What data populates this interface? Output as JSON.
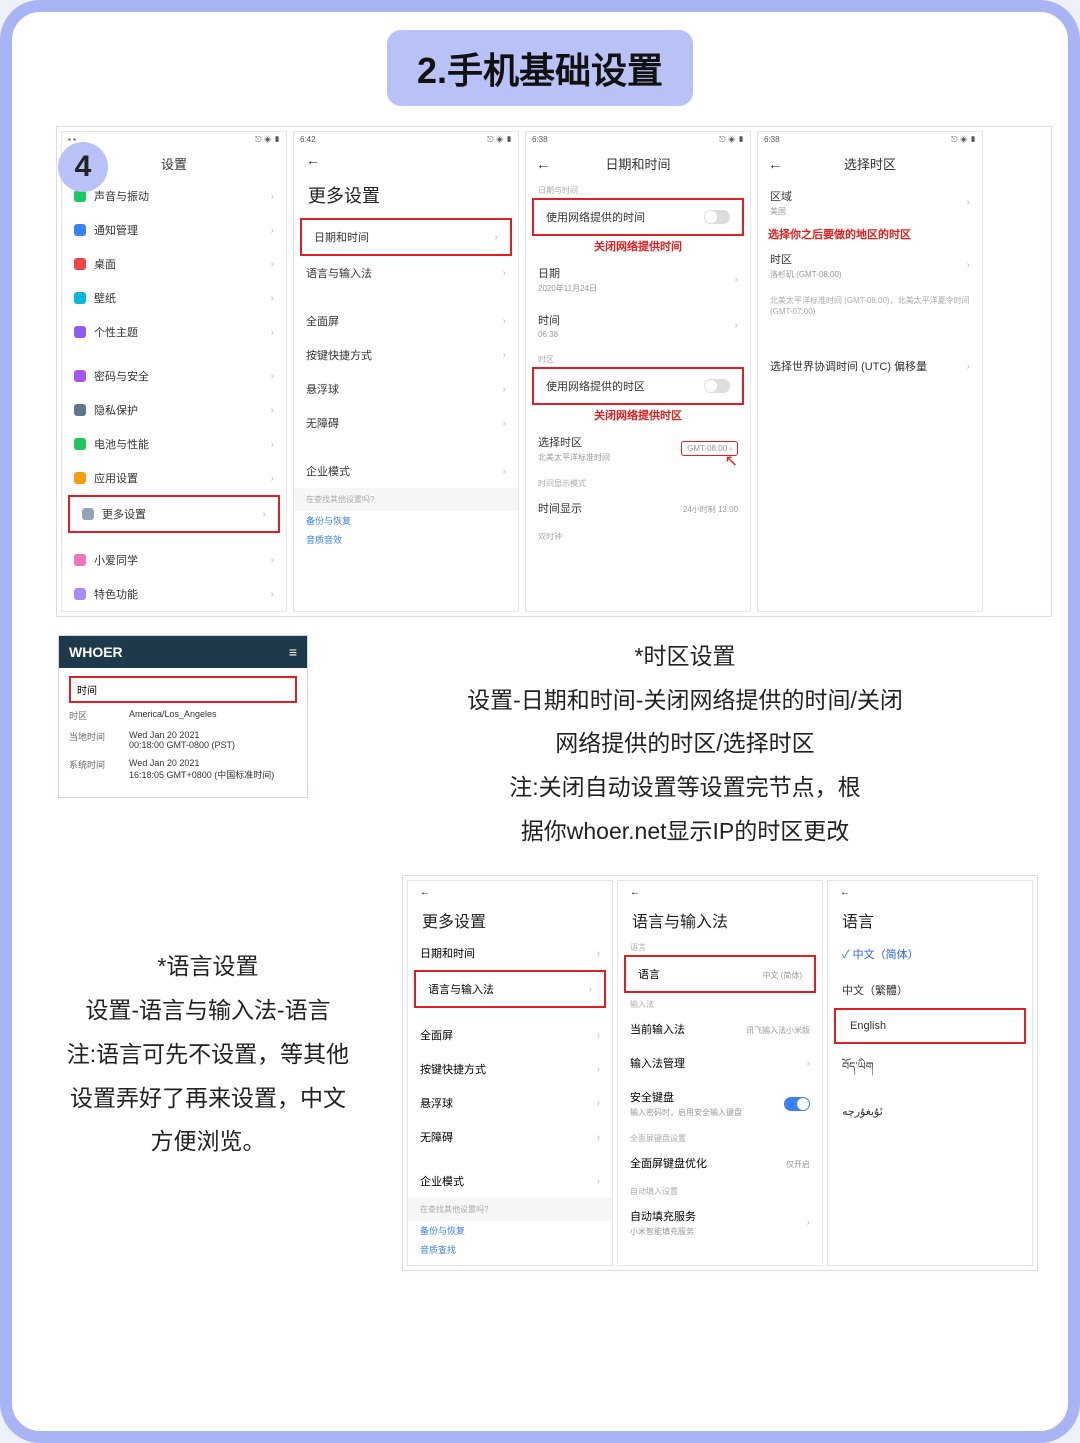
{
  "title": "2.手机基础设置",
  "step": "4",
  "topRow": {
    "p1": {
      "time": "",
      "header": "设置",
      "items": [
        "声音与振动",
        "通知管理",
        "桌面",
        "壁纸",
        "个性主题",
        "密码与安全",
        "隐私保护",
        "电池与性能",
        "应用设置",
        "更多设置",
        "小爱同学",
        "特色功能"
      ]
    },
    "p2": {
      "time": "6:42",
      "header": "更多设置",
      "items": [
        "日期和时间",
        "语言与输入法",
        "全面屏",
        "按键快捷方式",
        "悬浮球",
        "无障碍",
        "企业模式"
      ],
      "footQ": "在查找其他设置吗?",
      "footLinks": [
        "备份与恢复",
        "音质音效"
      ]
    },
    "p3": {
      "time": "6:38",
      "header": "日期和时间",
      "secA": "日期与时间",
      "netTime": "使用网络提供的时间",
      "note1": "关闭网络提供时间",
      "dateLab": "日期",
      "dateVal": "2020年11月24日",
      "timeLab": "时间",
      "timeVal": "06:38",
      "secB": "时区",
      "netZone": "使用网络提供的时区",
      "note2": "关闭网络提供时区",
      "selZone": "选择时区",
      "selZoneSub": "北美太平洋标准时间",
      "gmt": "GMT-08:00",
      "secC": "时间显示模式",
      "timeDisp": "时间显示",
      "timeDispVal": "24小时制 13:00",
      "secD": "双时钟"
    },
    "p4": {
      "time": "6:38",
      "header": "选择时区",
      "region": "区域",
      "regionVal": "美国",
      "annot": "选择你之后要做的地区的时区",
      "tzLab": "时区",
      "tzVal": "洛杉矶 (GMT-08:00)",
      "tzSub": "北美太平洋标准时间 (GMT-08:00)，北美太平洋夏令时间 (GMT-07:00)",
      "utc": "选择世界协调时间 (UTC) 偏移量"
    }
  },
  "explain1": {
    "t": "*时区设置",
    "l1": "设置-日期和时间-关闭网络提供的时间/关闭",
    "l2": "网络提供的时区/选择时区",
    "l3": "注:关闭自动设置等设置完节点，根",
    "l4": "据你whoer.net显示IP的时区更改"
  },
  "whoer": {
    "brand": "WHOER",
    "menu": "≡",
    "tab": "时间",
    "rows": [
      {
        "k": "时区",
        "v": "America/Los_Angeles"
      },
      {
        "k": "当地时间",
        "v": "Wed Jan 20 2021\n00:18:00 GMT-0800 (PST)"
      },
      {
        "k": "系统时间",
        "v": "Wed Jan 20 2021\n16:18:05 GMT+0800 (中国标准时间)"
      }
    ]
  },
  "explain2": {
    "t": "*语言设置",
    "l1": "设置-语言与输入法-语言",
    "l2": "注:语言可先不设置，等其他",
    "l3": "设置弄好了再来设置，中文",
    "l4": "方便浏览。"
  },
  "bottomRow": {
    "p1": {
      "header": "更多设置",
      "items": [
        "日期和时间",
        "语言与输入法",
        "全面屏",
        "按键快捷方式",
        "悬浮球",
        "无障碍",
        "企业模式"
      ],
      "footQ": "在查找其他设置吗?",
      "footLinks": [
        "备份与恢复",
        "音质查找"
      ]
    },
    "p2": {
      "header": "语言与输入法",
      "secLang": "语言",
      "langItem": "语言",
      "langVal": "中文 (简体)",
      "secIme": "输入法",
      "curIme": "当前输入法",
      "curImeVal": "讯飞输入法小米版",
      "imeManage": "输入法管理",
      "safeKb": "安全键盘",
      "safeKbSub": "输入密码时，启用安全输入键盘",
      "secFull": "全面屏键盘设置",
      "fullOpt": "全面屏键盘优化",
      "fullOptVal": "仅开启",
      "secAuto": "自动填入设置",
      "autoFill": "自动填充服务",
      "autoFillSub": "小米智能填充服务"
    },
    "p3": {
      "header": "语言",
      "items": [
        {
          "label": "中文（简体）",
          "sel": true
        },
        {
          "label": "中文（繁體）",
          "sel": false
        },
        {
          "label": "English",
          "sel": false,
          "hl": true
        },
        {
          "label": "བོད་ཡིག",
          "sel": false
        },
        {
          "label": "ئۇيغۇرچە",
          "sel": false
        }
      ]
    }
  }
}
